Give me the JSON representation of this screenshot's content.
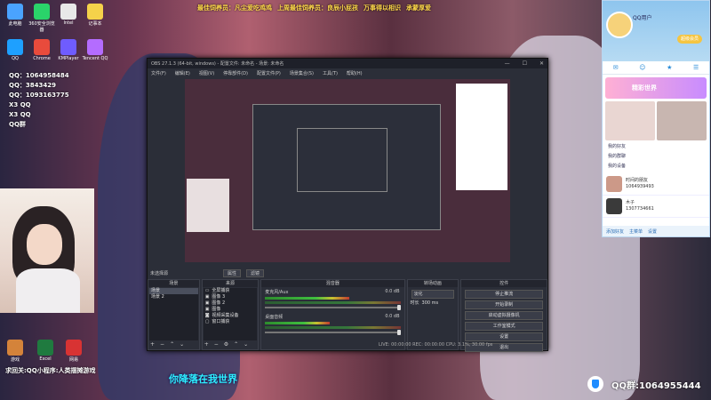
{
  "banner": {
    "items": [
      "最佳饲养员：凡尘爱吃鸡鸡",
      "上周最佳饲养员：良辰小屁孩",
      "万事得以相识",
      "承蒙厚爱"
    ]
  },
  "desktop": {
    "icons_top": [
      "此电脑",
      "360安全浏览器",
      "Intel",
      "记事本",
      "QQ",
      "Chrome",
      "KMPlayer",
      "Tencent QQ"
    ],
    "qq_overlay": [
      "QQ：1064958484",
      "QQ：3843429",
      "QQ：1093163775",
      "X3 QQ",
      "X3 QQ",
      "QQ群"
    ],
    "bottom_icons": [
      "游戏",
      "Excel",
      "网易"
    ],
    "caption_bottom_left": "求回关:QQ小程序:人类摆摊游戏",
    "caption_bottom_center": "你降落在我世界",
    "qq_group": "QQ群:1064955444"
  },
  "obs": {
    "title": "OBS 27.1.3 (64-bit, windows) - 配置文件: 未命名 - 场景: 未命名",
    "menu": [
      "文件(F)",
      "编辑(E)",
      "视图(V)",
      "停靠部件(D)",
      "配置文件(P)",
      "场景集合(S)",
      "工具(T)",
      "帮助(H)"
    ],
    "window_buttons": [
      "—",
      "☐",
      "✕"
    ],
    "preview_label": "未选择源",
    "preview_buttons": [
      "属性",
      "滤镜"
    ],
    "docks": {
      "scenes": {
        "title": "场景",
        "items": [
          "场景",
          "场景 2"
        ],
        "selected": 0
      },
      "sources": {
        "title": "来源",
        "items": [
          "全屏捕获",
          "图像 3",
          "图像 2",
          "图像",
          "视频采集设备",
          "窗口捕获"
        ]
      },
      "mixer": {
        "title": "混音器",
        "tracks": [
          {
            "name": "麦克风/Aux",
            "db": "0.0 dB",
            "level": 0.62
          },
          {
            "name": "桌面音频",
            "db": "0.0 dB",
            "level": 0.48
          }
        ]
      },
      "transitions": {
        "title": "转场动画",
        "type": "淡化",
        "duration_label": "时长",
        "duration": "300 ms"
      },
      "controls": {
        "title": "控件",
        "buttons": [
          "停止推流",
          "开始录制",
          "启动虚拟摄像机",
          "工作室模式",
          "设置",
          "退出"
        ]
      }
    },
    "status": "LIVE: 00:00:00  REC: 00:00:00  CPU: 3.1%, 30.00 fps"
  },
  "qq_panel": {
    "name": "QQ用户",
    "vip": "超级会员",
    "promo": "精彩世界",
    "sections": [
      "我的好友",
      "我的群聊",
      "我的设备"
    ],
    "contacts": [
      {
        "name": "时间的朋友",
        "id": "1064939493"
      },
      {
        "name": "木子",
        "id": "1307734661"
      }
    ],
    "footer": [
      "添加好友",
      "主菜单",
      "设置"
    ]
  }
}
